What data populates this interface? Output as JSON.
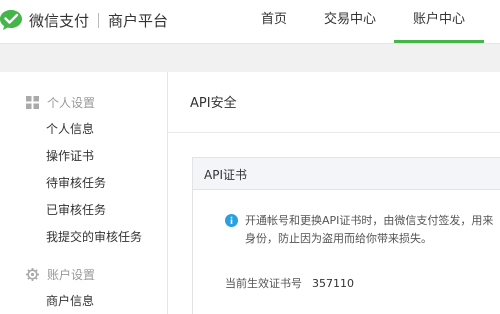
{
  "brand": {
    "name": "微信支付",
    "subtitle": "商户平台",
    "accent_color": "#44b549"
  },
  "nav": {
    "items": [
      {
        "label": "首页",
        "active": false
      },
      {
        "label": "交易中心",
        "active": false
      },
      {
        "label": "账户中心",
        "active": true
      }
    ]
  },
  "sidebar": {
    "sections": [
      {
        "label": "个人设置",
        "icon": "grid-icon",
        "items": [
          "个人信息",
          "操作证书",
          "待审核任务",
          "已审核任务",
          "我提交的审核任务"
        ]
      },
      {
        "label": "账户设置",
        "icon": "gear-icon",
        "items": [
          "商户信息"
        ]
      }
    ]
  },
  "main": {
    "title": "API安全",
    "card": {
      "title": "API证书",
      "info_line1": "开通帐号和更换API证书时，由微信支付签发，用来",
      "info_line2": "身份，防止因为盗用而给你带来损失。",
      "serial_label": "当前生效证书号",
      "serial_value": "357110"
    }
  }
}
